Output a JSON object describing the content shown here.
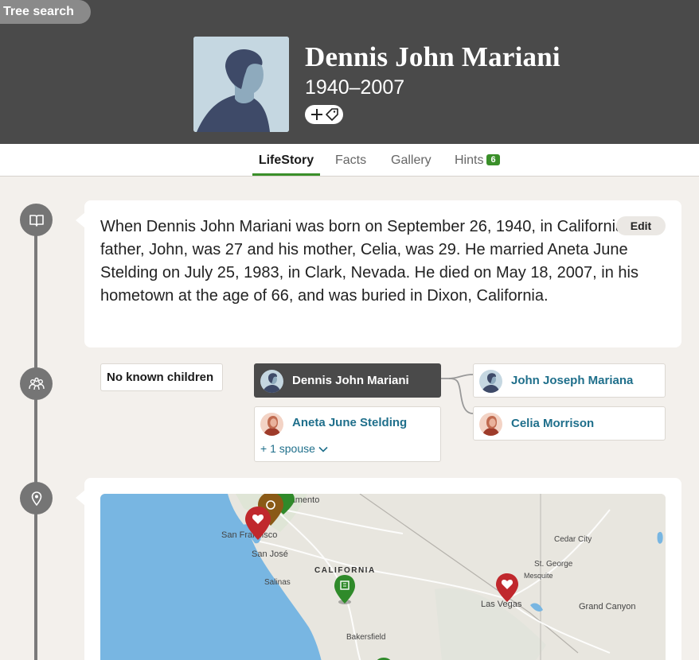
{
  "header": {
    "tree_search": "Tree search",
    "name": "Dennis John Mariani",
    "years": "1940–2007"
  },
  "tabs": [
    {
      "label": "LifeStory",
      "active": true
    },
    {
      "label": "Facts"
    },
    {
      "label": "Gallery"
    },
    {
      "label": "Hints",
      "badge": "6"
    }
  ],
  "story": {
    "text": "When Dennis John Mariani was born on September 26, 1940, in California, his father, John, was 27 and his mother, Celia, was 29. He married Aneta June Stelding on July 25, 1983, in Clark, Nevada. He died on May 18, 2007, in his hometown at the age of 66, and was buried in Dixon, California.",
    "edit_label": "Edit"
  },
  "family": {
    "children_label": "No known children",
    "self": "Dennis John Mariani",
    "spouse": "Aneta June Stelding",
    "more_spouse": "+ 1 spouse",
    "father": "John Joseph Mariana",
    "mother": "Celia Morrison"
  },
  "map": {
    "labels": {
      "sacramento": "Sacramento",
      "san_francisco": "San Francisco",
      "san_jose": "San José",
      "salinas": "Salinas",
      "california": "CALIFORNIA",
      "bakersfield": "Bakersfield",
      "las_vegas": "Las Vegas",
      "cedar_city": "Cedar City",
      "st_george": "St. George",
      "mesquite": "Mesquite",
      "grand_canyon": "Grand Canyon"
    }
  },
  "colors": {
    "header_bg": "#4a4a4a",
    "accent_green": "#3a8f29",
    "link_blue": "#1f6f8b",
    "pin_red": "#c0282d",
    "pin_green": "#2f8a2a",
    "pin_brown": "#8a5a16",
    "water": "#78b6e2"
  }
}
